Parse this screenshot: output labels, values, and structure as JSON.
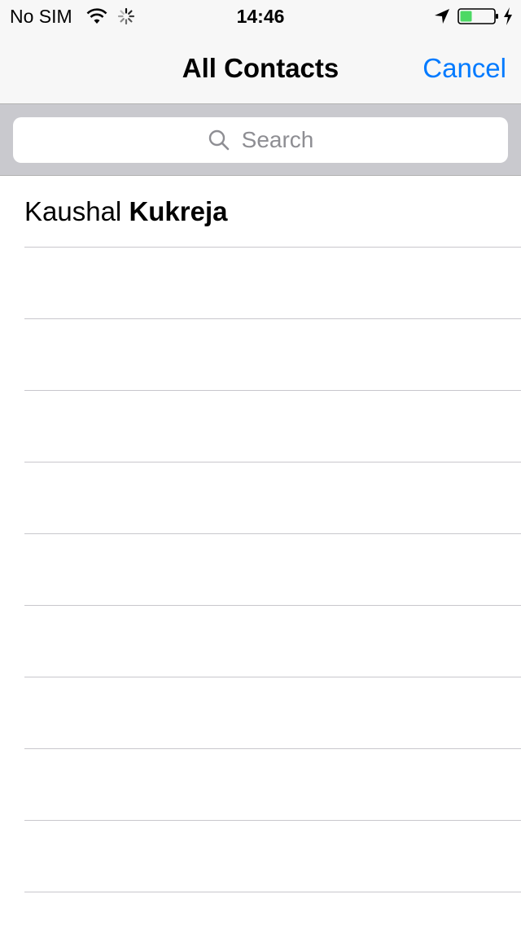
{
  "status_bar": {
    "carrier": "No SIM",
    "time": "14:46",
    "icons": [
      "wifi-icon",
      "activity-spinner-icon",
      "location-arrow-icon",
      "battery-icon",
      "charging-bolt-icon"
    ],
    "battery_level_fraction": 0.35,
    "battery_color": "#4cd964"
  },
  "nav_bar": {
    "title": "All Contacts",
    "cancel_label": "Cancel",
    "accent_color": "#007aff"
  },
  "search": {
    "placeholder": "Search",
    "icon": "search-icon"
  },
  "contacts": [
    {
      "first_name": "Kaushal",
      "last_name": "Kukreja"
    }
  ],
  "empty_rows_visible": 10
}
